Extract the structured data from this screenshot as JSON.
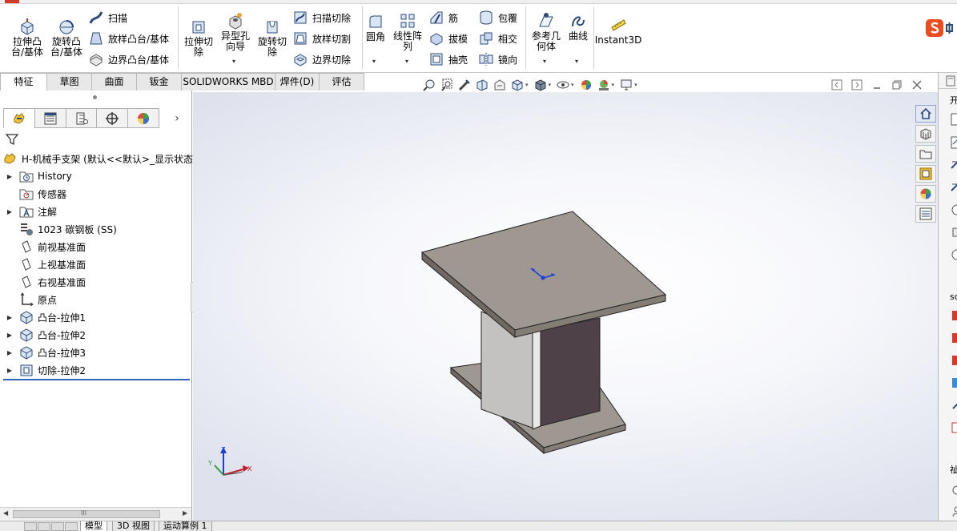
{
  "ribbon": {
    "extrude_boss": "拉伸凸\n台/基体",
    "revolve_boss": "旋转凸\n台/基体",
    "sweep": "扫描",
    "loft_boss": "放样凸台/基体",
    "boundary_boss": "边界凸台/基体",
    "extrude_cut": "拉伸切\n除",
    "hole_wizard": "异型孔\n向导",
    "revolve_cut": "旋转切\n除",
    "swept_cut": "扫描切除",
    "lofted_cut": "放样切割",
    "boundary_cut": "边界切除",
    "fillet": "圆角",
    "linear_pattern": "线性阵\n列",
    "rib": "筋",
    "draft": "拔模",
    "shell": "抽壳",
    "wrap": "包覆",
    "intersect": "相交",
    "mirror": "镜向",
    "reference_geometry": "参考几\n何体",
    "curves": "曲线",
    "instant3d": "Instant3D"
  },
  "tabs": [
    "特征",
    "草图",
    "曲面",
    "钣金",
    "SOLIDWORKS MBD",
    "焊件(D)",
    "评估"
  ],
  "tree": {
    "root": "H-机械手支架 (默认<<默认>_显示状态",
    "items": [
      {
        "label": "History",
        "icon": "history-folder-icon",
        "expand": true
      },
      {
        "label": "传感器",
        "icon": "sensor-icon",
        "expand": false
      },
      {
        "label": "注解",
        "icon": "annotation-icon",
        "expand": true
      },
      {
        "label": "1023 碳钢板 (SS)",
        "icon": "material-icon",
        "expand": false
      },
      {
        "label": "前视基准面",
        "icon": "plane-icon",
        "expand": false
      },
      {
        "label": "上视基准面",
        "icon": "plane-icon",
        "expand": false
      },
      {
        "label": "右视基准面",
        "icon": "plane-icon",
        "expand": false
      },
      {
        "label": "原点",
        "icon": "origin-icon",
        "expand": false
      },
      {
        "label": "凸台-拉伸1",
        "icon": "extrude-feature-icon",
        "expand": true
      },
      {
        "label": "凸台-拉伸2",
        "icon": "extrude-feature-icon",
        "expand": true
      },
      {
        "label": "凸台-拉伸3",
        "icon": "extrude-feature-icon",
        "expand": true
      },
      {
        "label": "切除-拉伸2",
        "icon": "cut-feature-icon",
        "expand": true
      }
    ]
  },
  "triad": {
    "x": "X",
    "y": "Y",
    "z": "Z"
  },
  "bottom_tabs": [
    "模型",
    "3D 视图",
    "运动算例 1"
  ],
  "scroll_grip": "III",
  "right_pane_fragments": [
    "开",
    "sc",
    "祉"
  ],
  "colors": {
    "part_top": "#9e9891",
    "part_front": "#847d76",
    "web_dark": "#4e4248",
    "web_light": "#c4c2c0",
    "viewport_edge": "#dfe2ed",
    "rollback_bar": "#3060c0"
  }
}
